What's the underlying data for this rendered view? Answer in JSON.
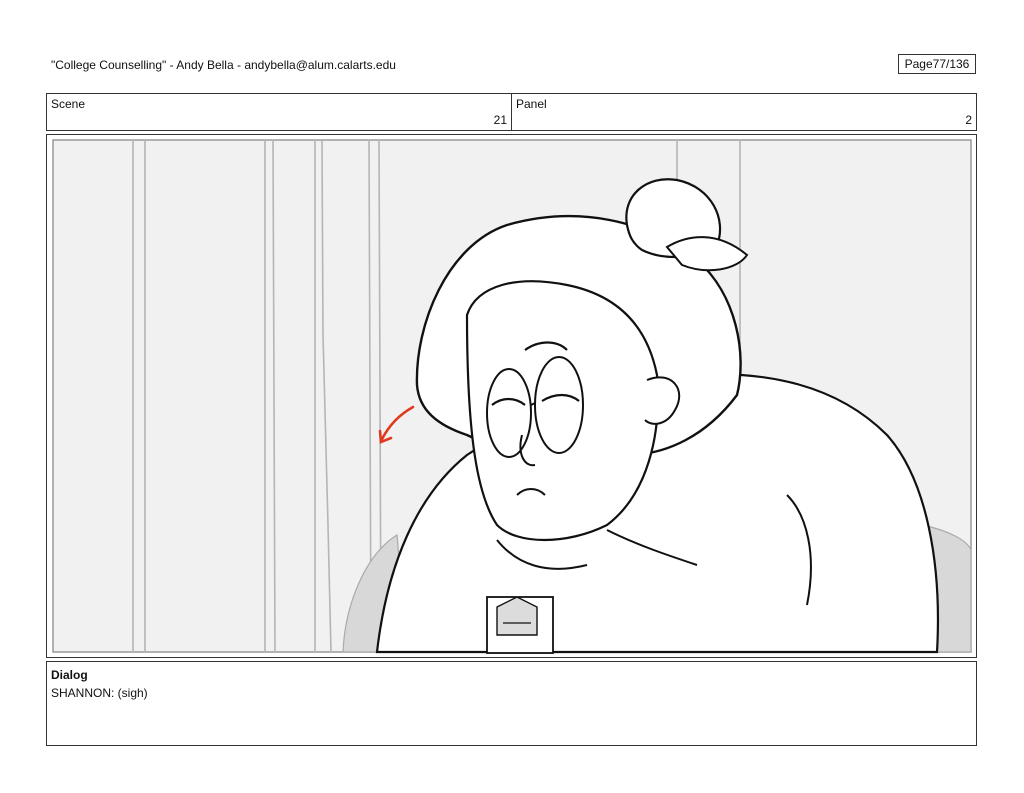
{
  "header": {
    "title": "\"College Counselling\"",
    "author": "Andy Bella",
    "email": "andybella@alum.calarts.edu",
    "separator": " - ",
    "page_label": "Page",
    "page_value": "77/136"
  },
  "scene": {
    "label": "Scene",
    "value": "21"
  },
  "panel": {
    "label": "Panel",
    "value": "2"
  },
  "frame": {
    "drawing": "storyboard-sketch",
    "accent_color": "#e03a1e",
    "line_color": "#111111",
    "background_color": "#f1f1f1"
  },
  "dialog": {
    "label": "Dialog",
    "text": "SHANNON: (sigh)"
  }
}
